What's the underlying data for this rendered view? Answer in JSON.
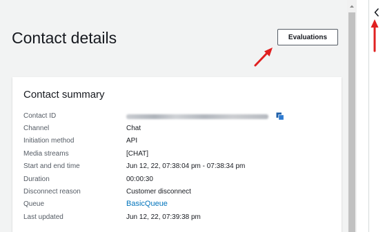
{
  "page": {
    "title": "Contact details"
  },
  "header": {
    "evaluations_label": "Evaluations"
  },
  "summary": {
    "title": "Contact summary",
    "rows": [
      {
        "label": "Contact ID",
        "value": ""
      },
      {
        "label": "Channel",
        "value": "Chat"
      },
      {
        "label": "Initiation method",
        "value": "API"
      },
      {
        "label": "Media streams",
        "value": "[CHAT]"
      },
      {
        "label": "Start and end time",
        "value": "Jun 12, 22, 07:38:04 pm - 07:38:34 pm"
      },
      {
        "label": "Duration",
        "value": "00:00:30"
      },
      {
        "label": "Disconnect reason",
        "value": "Customer disconnect"
      },
      {
        "label": "Queue",
        "value": "BasicQueue"
      },
      {
        "label": "Last updated",
        "value": "Jun 12, 22, 07:39:38 pm"
      }
    ]
  },
  "icons": {
    "copy": "copy-icon",
    "collapse": "chevron-left-icon",
    "scroll_up": "caret-up-icon",
    "annotation": "red-arrow-icon"
  },
  "colors": {
    "page_bg": "#f2f3f3",
    "card_bg": "#ffffff",
    "link": "#0073bb",
    "annotation_arrow": "#e02020",
    "copy_icon": "#1f5fa8"
  }
}
